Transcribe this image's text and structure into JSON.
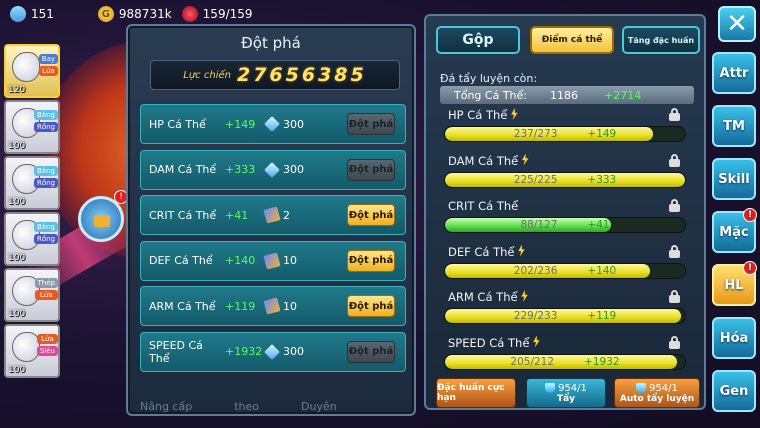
{
  "topbar": {
    "gems": "151",
    "gold": "988731k",
    "stamina": "159/159"
  },
  "pokemon_list": [
    {
      "level": "120",
      "types": [
        "Bay",
        "Lửa"
      ],
      "selected": true
    },
    {
      "level": "100",
      "types": [
        "Băng",
        "Rồng"
      ],
      "selected": false
    },
    {
      "level": "100",
      "types": [
        "Băng",
        "Rồng"
      ],
      "selected": false
    },
    {
      "level": "100",
      "types": [
        "Băng",
        "Rồng"
      ],
      "selected": false
    },
    {
      "level": "100",
      "types": [
        "Thép",
        "Lửa"
      ],
      "selected": false
    },
    {
      "level": "100",
      "types": [
        "Lửa",
        "Siêu"
      ],
      "selected": false
    }
  ],
  "left_panel": {
    "title": "Đột phá",
    "power_label": "Lực chiến",
    "power_value": "27656385",
    "rows": [
      {
        "name": "HP Cá Thể",
        "inc": "+149",
        "cost_icon": "diamond-icon",
        "cost": "300",
        "button": "Đột phá",
        "enabled": false
      },
      {
        "name": "DAM Cá Thể",
        "inc": "+333",
        "cost_icon": "diamond-icon",
        "cost": "300",
        "button": "Đột phá",
        "enabled": false
      },
      {
        "name": "CRIT Cá Thể",
        "inc": "+41",
        "cost_icon": "book-icon",
        "cost": "2",
        "button": "Đột phá",
        "enabled": true
      },
      {
        "name": "DEF Cá Thể",
        "inc": "+140",
        "cost_icon": "book-icon",
        "cost": "10",
        "button": "Đột phá",
        "enabled": true
      },
      {
        "name": "ARM Cá Thể",
        "inc": "+119",
        "cost_icon": "book-icon",
        "cost": "10",
        "button": "Đột phá",
        "enabled": true
      },
      {
        "name": "SPEED Cá Thể",
        "inc": "+1932",
        "cost_icon": "diamond-icon",
        "cost": "300",
        "button": "Đột phá",
        "enabled": false
      }
    ],
    "bottom_labels": [
      "Nâng cấp",
      "theo",
      "Duyên"
    ]
  },
  "right_panel": {
    "tabs": [
      "Gộp",
      "Điểm cá thể",
      "Tăng đặc huấn"
    ],
    "active_tab": 1,
    "remain_label": "Đá tẩy luyện còn:",
    "total": {
      "label": "Tổng Cá Thể:",
      "value": "1186",
      "inc": "+2714"
    },
    "stats": [
      {
        "name": "HP Cá Thể",
        "bolt": true,
        "current": 237,
        "max": 273,
        "text": "237/273",
        "inc": "+149",
        "color": "yellow"
      },
      {
        "name": "DAM Cá Thể",
        "bolt": true,
        "current": 225,
        "max": 225,
        "text": "225/225",
        "inc": "+333",
        "color": "yellow"
      },
      {
        "name": "CRIT Cá Thể",
        "bolt": false,
        "current": 88,
        "max": 127,
        "text": "88/127",
        "inc": "+41",
        "color": "green"
      },
      {
        "name": "DEF Cá Thể",
        "bolt": true,
        "current": 202,
        "max": 236,
        "text": "202/236",
        "inc": "+140",
        "color": "yellow"
      },
      {
        "name": "ARM Cá Thể",
        "bolt": true,
        "current": 229,
        "max": 233,
        "text": "229/233",
        "inc": "+119",
        "color": "yellow"
      },
      {
        "name": "SPEED Cá Thể",
        "bolt": true,
        "current": 205,
        "max": 212,
        "text": "205/212",
        "inc": "+1932",
        "color": "yellow"
      }
    ],
    "buttons": [
      {
        "label": "Đặc huấn cực hạn"
      },
      {
        "count": "954/1",
        "label": "Tẩy"
      },
      {
        "count": "954/1",
        "label": "Auto tẩy luyện"
      }
    ]
  },
  "side_menu": [
    {
      "label": "Attr",
      "badge": false,
      "active": false
    },
    {
      "label": "TM",
      "badge": false,
      "active": false
    },
    {
      "label": "Skill",
      "badge": false,
      "active": false
    },
    {
      "label": "Mặc",
      "badge": true,
      "active": false
    },
    {
      "label": "HL",
      "badge": true,
      "active": true
    },
    {
      "label": "Hóa",
      "badge": false,
      "active": false
    },
    {
      "label": "Gen",
      "badge": false,
      "active": false
    }
  ],
  "close_label": "✕",
  "badge_text": "!"
}
